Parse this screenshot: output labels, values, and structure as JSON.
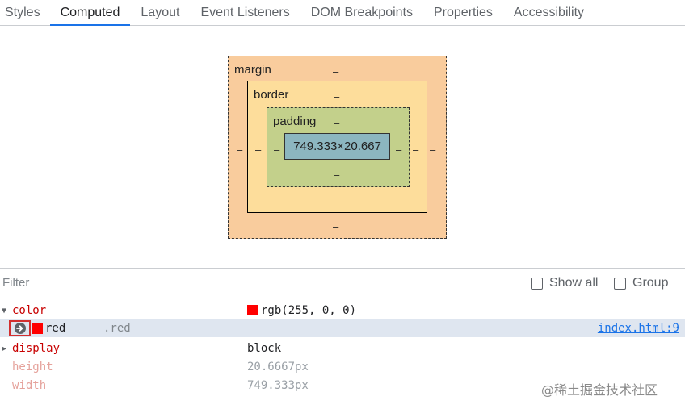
{
  "tabs": [
    {
      "label": "Styles"
    },
    {
      "label": "Computed"
    },
    {
      "label": "Layout"
    },
    {
      "label": "Event Listeners"
    },
    {
      "label": "DOM Breakpoints"
    },
    {
      "label": "Properties"
    },
    {
      "label": "Accessibility"
    }
  ],
  "active_tab": "Computed",
  "box_model": {
    "margin_label": "margin",
    "border_label": "border",
    "padding_label": "padding",
    "content_size": "749.333×20.667",
    "dash": "–",
    "colors": {
      "margin": "#f9cc9d",
      "border": "#fddd9b",
      "padding": "#c3d08b",
      "content": "#8cb6c0"
    }
  },
  "filter": {
    "placeholder": "Filter",
    "show_all_label": "Show all",
    "group_label": "Group"
  },
  "properties": [
    {
      "name": "color",
      "value": "rgb(255, 0, 0)",
      "expanded": true,
      "inherited": false,
      "swatch": "#ff0000"
    },
    {
      "name": "display",
      "value": "block",
      "expanded": false,
      "inherited": false
    },
    {
      "name": "height",
      "value": "20.6667px",
      "inherited": true
    },
    {
      "name": "width",
      "value": "749.333px",
      "inherited": true
    }
  ],
  "trace": {
    "value": "red",
    "selector": ".red",
    "source_link": "index.html:9",
    "icon": "goto-source-arrow-icon"
  },
  "watermark": "@稀土掘金技术社区"
}
